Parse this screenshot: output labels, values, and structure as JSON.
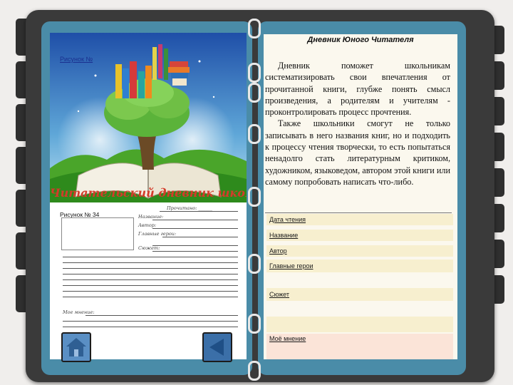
{
  "left_page": {
    "figure1_caption": "Рисунок №",
    "figure2_caption": "Рисунок № 34",
    "illustration_title": "Читательский дневник школьника",
    "form": {
      "line1": "Прочитано: ______",
      "line2": "Название:",
      "line3": "Автор:",
      "line4": "Главные герои:",
      "line5": "Сюжет:",
      "line6": "Мое мнение:"
    }
  },
  "right_page": {
    "title": "Дневник Юного Читателя",
    "paragraph1": "Дневник поможет школьникам систематизировать свои впечатления от прочитанной книги, глубже понять смысл произведения, а родителям и учителям - проконтролировать процесс прочтения.",
    "paragraph2": "Также школьники смогут не только записывать в него названия книг, но и подходить к процессу чтения творчески, то есть попытаться ненадолго стать литературным критиком, художником, языковедом, автором этой книги или самому попробовать написать что-либо.",
    "fields": [
      {
        "label": "Дата чтения"
      },
      {
        "label": "Название"
      },
      {
        "label": "Автор"
      },
      {
        "label": "Главные герои"
      },
      {
        "label": "Сюжет"
      },
      {
        "label": "Моё мнение"
      }
    ]
  },
  "nav": {
    "home_icon": "house-icon",
    "back_icon": "left-triangle-icon"
  },
  "colors": {
    "cover": "#3a3a3a",
    "page_teal": "#4a8ca8",
    "field_fill": "#f7efcf",
    "nav_button": "#3b6fa8"
  }
}
